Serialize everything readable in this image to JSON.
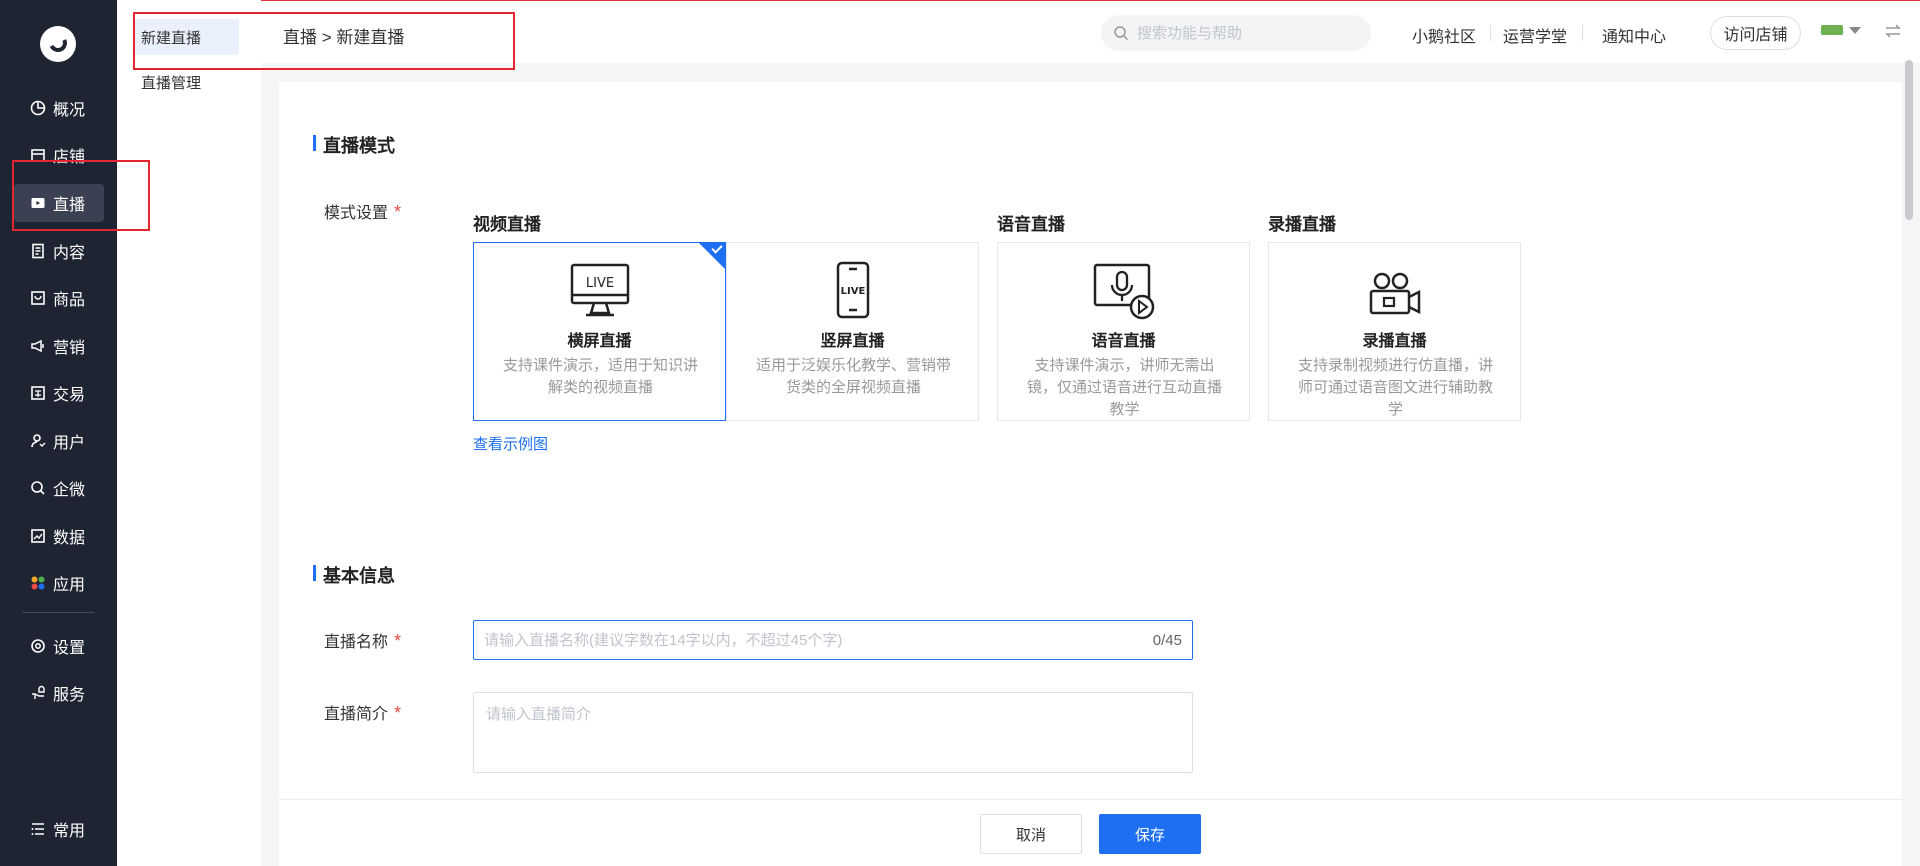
{
  "nav": {
    "items": [
      {
        "label": "概况",
        "icon": "overview-icon"
      },
      {
        "label": "店铺",
        "icon": "store-icon"
      },
      {
        "label": "直播",
        "icon": "live-icon"
      },
      {
        "label": "内容",
        "icon": "content-icon"
      },
      {
        "label": "商品",
        "icon": "goods-icon"
      },
      {
        "label": "营销",
        "icon": "marketing-icon"
      },
      {
        "label": "交易",
        "icon": "trade-icon"
      },
      {
        "label": "用户",
        "icon": "user-icon"
      },
      {
        "label": "企微",
        "icon": "wecom-icon"
      },
      {
        "label": "数据",
        "icon": "data-icon"
      },
      {
        "label": "应用",
        "icon": "apps-icon"
      },
      {
        "label": "设置",
        "icon": "settings-icon"
      },
      {
        "label": "服务",
        "icon": "service-icon"
      },
      {
        "label": "常用",
        "icon": "frequent-icon"
      }
    ],
    "active": "直播"
  },
  "subnav": {
    "items": [
      {
        "label": "新建直播"
      },
      {
        "label": "直播管理"
      }
    ]
  },
  "topbar": {
    "breadcrumb": "直播 > 新建直播",
    "search_placeholder": "搜索功能与帮助",
    "links": [
      "小鹅社区",
      "运营学堂",
      "通知中心"
    ],
    "visit_store": "访问店铺"
  },
  "sections": {
    "mode": {
      "title": "直播模式",
      "field_label": "模式设置",
      "groups": [
        "视频直播",
        "语音直播",
        "录播直播"
      ],
      "cards": [
        {
          "title": "横屏直播",
          "desc": "支持课件演示，适用于知识讲解类的视频直播",
          "selected": true,
          "icon": "live-monitor-icon",
          "icon_text": "LIVE"
        },
        {
          "title": "竖屏直播",
          "desc": "适用于泛娱乐化教学、营销带货类的全屏视频直播",
          "selected": false,
          "icon": "live-phone-icon",
          "icon_text": "LIVE"
        },
        {
          "title": "语音直播",
          "desc": "支持课件演示，讲师无需出镜，仅通过语音进行互动直播教学",
          "selected": false,
          "icon": "voice-live-icon"
        },
        {
          "title": "录播直播",
          "desc": "支持录制视频进行仿直播，讲师可通过语音图文进行辅助教学",
          "selected": false,
          "icon": "video-camera-icon"
        }
      ],
      "example_link": "查看示例图"
    },
    "basic": {
      "title": "基本信息",
      "name_label": "直播名称",
      "name_placeholder": "请输入直播名称(建议字数在14字以内，不超过45个字)",
      "name_counter": "0/45",
      "intro_label": "直播简介",
      "intro_placeholder": "请输入直播简介"
    }
  },
  "footer": {
    "cancel": "取消",
    "save": "保存"
  },
  "colors": {
    "primary": "#1e6ff1",
    "nav_bg": "#1f2433",
    "required": "#e94a4a",
    "annotation": "#e3262f"
  }
}
